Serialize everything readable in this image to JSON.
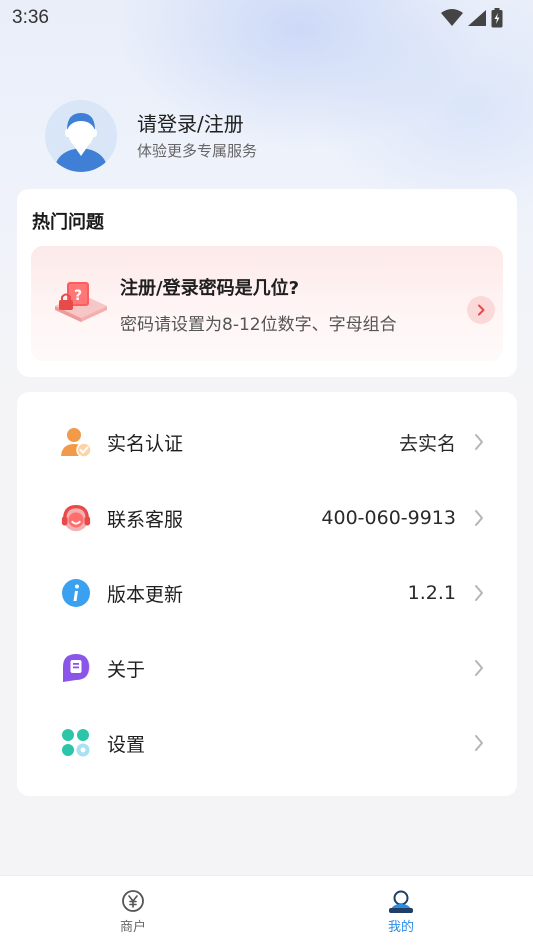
{
  "status_bar": {
    "time": "3:36"
  },
  "profile": {
    "title": "请登录/注册",
    "subtitle": "体验更多专属服务",
    "avatar_icon": "user-avatar-icon"
  },
  "faq": {
    "heading": "热门问题",
    "question": "注册/登录密码是几位?",
    "answer": "密码请设置为8-12位数字、字母组合",
    "accent_color": "#e84a4a"
  },
  "menu": {
    "items": [
      {
        "label": "实名认证",
        "value": "去实名",
        "icon": "user-verify-icon"
      },
      {
        "label": "联系客服",
        "value": "400-060-9913",
        "icon": "customer-service-icon"
      },
      {
        "label": "版本更新",
        "value": "1.2.1",
        "icon": "info-icon"
      },
      {
        "label": "关于",
        "value": "",
        "icon": "about-chat-icon"
      },
      {
        "label": "设置",
        "value": "",
        "icon": "settings-icon"
      }
    ]
  },
  "tabbar": {
    "tabs": [
      {
        "label": "商户",
        "icon": "merchant-yen-icon",
        "active": false
      },
      {
        "label": "我的",
        "icon": "mine-user-icon",
        "active": true
      }
    ],
    "active_color": "#2a8ee8"
  }
}
